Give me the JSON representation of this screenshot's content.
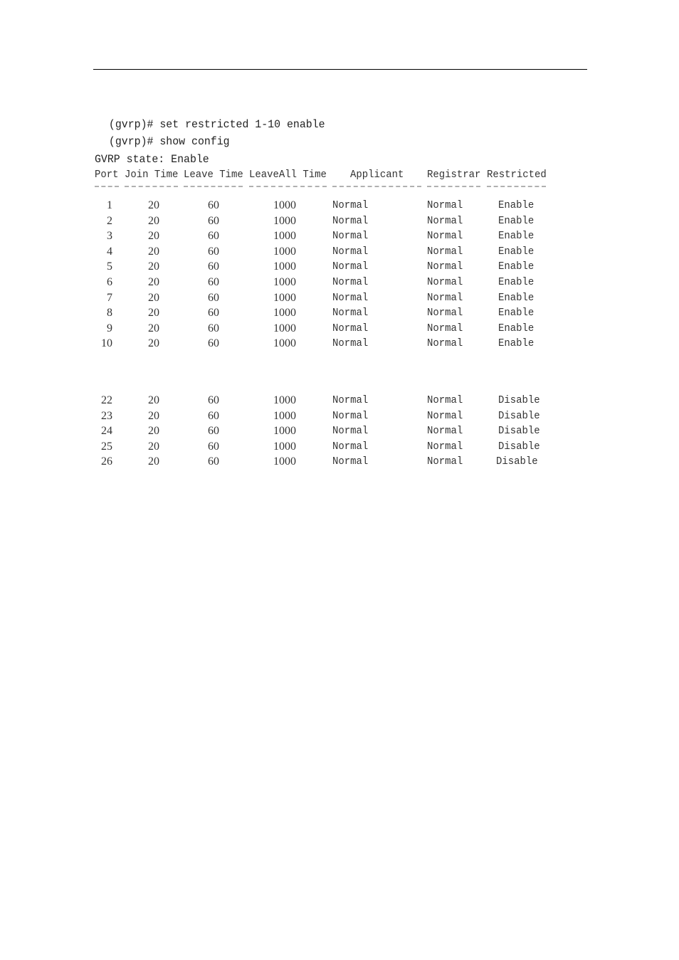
{
  "document": {
    "commands": [
      " (gvrp)# set restricted 1-10 enable",
      " (gvrp)# show config"
    ],
    "state_line": "GVRP state: Enable",
    "table": {
      "headers": [
        "Port",
        "Join Time",
        "Leave Time",
        "LeaveAll Time",
        "Applicant",
        "Registrar",
        "Restricted"
      ],
      "separators": [
        "----",
        "---------",
        "----------",
        "------------",
        "--------------",
        "---------",
        "----------"
      ],
      "groups": [
        {
          "rows": [
            {
              "port": "1",
              "join": "20",
              "leave": "60",
              "leaveall": "1000",
              "applicant": "Normal",
              "registrar": "Normal",
              "restricted": "Enable"
            },
            {
              "port": "2",
              "join": "20",
              "leave": "60",
              "leaveall": "1000",
              "applicant": "Normal",
              "registrar": "Normal",
              "restricted": "Enable"
            },
            {
              "port": "3",
              "join": "20",
              "leave": "60",
              "leaveall": "1000",
              "applicant": "Normal",
              "registrar": "Normal",
              "restricted": "Enable"
            },
            {
              "port": "4",
              "join": "20",
              "leave": "60",
              "leaveall": "1000",
              "applicant": "Normal",
              "registrar": "Normal",
              "restricted": "Enable"
            },
            {
              "port": "5",
              "join": "20",
              "leave": "60",
              "leaveall": "1000",
              "applicant": "Normal",
              "registrar": "Normal",
              "restricted": "Enable"
            },
            {
              "port": "6",
              "join": "20",
              "leave": "60",
              "leaveall": "1000",
              "applicant": "Normal",
              "registrar": "Normal",
              "restricted": "Enable"
            },
            {
              "port": "7",
              "join": "20",
              "leave": "60",
              "leaveall": "1000",
              "applicant": "Normal",
              "registrar": "Normal",
              "restricted": "Enable"
            },
            {
              "port": "8",
              "join": "20",
              "leave": "60",
              "leaveall": "1000",
              "applicant": "Normal",
              "registrar": "Normal",
              "restricted": "Enable"
            },
            {
              "port": "9",
              "join": "20",
              "leave": "60",
              "leaveall": "1000",
              "applicant": "Normal",
              "registrar": "Normal",
              "restricted": "Enable"
            },
            {
              "port": "10",
              "join": "20",
              "leave": "60",
              "leaveall": "1000",
              "applicant": "Normal",
              "registrar": "Normal",
              "restricted": "Enable"
            }
          ]
        },
        {
          "rows": [
            {
              "port": "22",
              "join": "20",
              "leave": "60",
              "leaveall": "1000",
              "applicant": "Normal",
              "registrar": "Normal",
              "restricted": "Disable"
            },
            {
              "port": "23",
              "join": "20",
              "leave": "60",
              "leaveall": "1000",
              "applicant": "Normal",
              "registrar": "Normal",
              "restricted": "Disable"
            },
            {
              "port": "24",
              "join": "20",
              "leave": "60",
              "leaveall": "1000",
              "applicant": "Normal",
              "registrar": "Normal",
              "restricted": "Disable"
            },
            {
              "port": "25",
              "join": "20",
              "leave": "60",
              "leaveall": "1000",
              "applicant": "Normal",
              "registrar": "Normal",
              "restricted": "Disable"
            },
            {
              "port": "26",
              "join": "20",
              "leave": "60",
              "leaveall": "1000",
              "applicant": "Normal",
              "registrar": "Normal",
              "restricted": "Disable"
            }
          ]
        }
      ]
    }
  }
}
